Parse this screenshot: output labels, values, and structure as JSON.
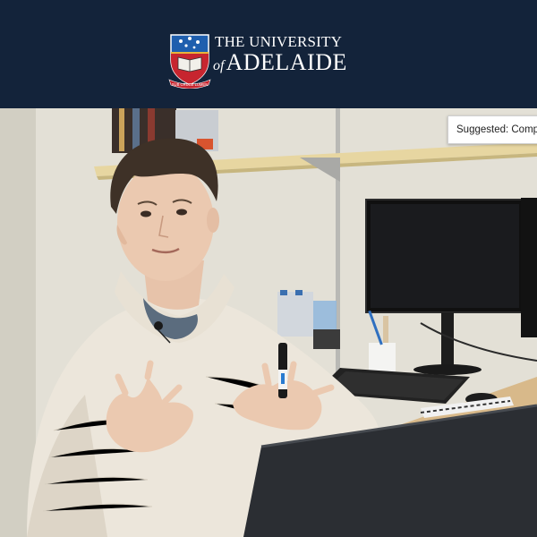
{
  "header": {
    "logo_line1": "THE UNIVERSITY",
    "logo_of": "of",
    "logo_line2": "ADELAIDE",
    "motto": "SUB CRUCE LUMEN",
    "background": "#13233a"
  },
  "video": {
    "suggestion_chip": "Suggested: Comp",
    "scene": "interview-man-at-desk"
  }
}
